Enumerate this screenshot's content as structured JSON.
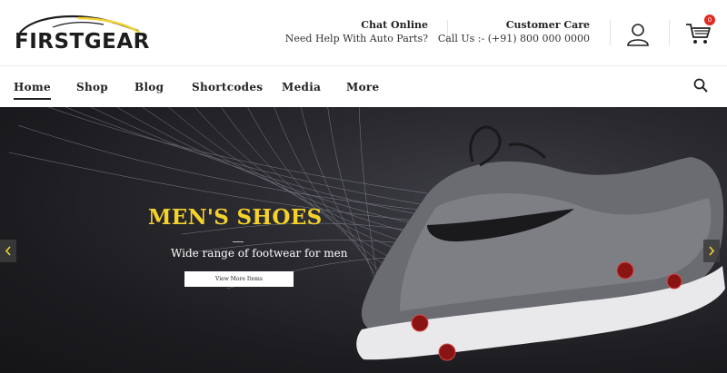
{
  "brand": {
    "name": "FIRSTGEAR",
    "accent": "#f4d22b"
  },
  "header": {
    "chat": {
      "title": "Chat Online",
      "subtitle": "Need Help With Auto Parts?"
    },
    "care": {
      "title": "Customer Care",
      "subtitle": "Call Us :- (+91) 800 000 0000"
    },
    "account_icon": "user-icon",
    "cart": {
      "icon": "cart-icon",
      "count": "0"
    }
  },
  "nav": {
    "items": [
      {
        "label": "Home",
        "active": true
      },
      {
        "label": "Shop"
      },
      {
        "label": "Blog"
      },
      {
        "label": "Shortcodes"
      },
      {
        "label": "Media"
      },
      {
        "label": "More"
      }
    ],
    "search_icon": "search-icon"
  },
  "hero": {
    "title": "MEN'S SHOES",
    "subtitle": "Wide range of footwear for men",
    "cta": "View More Items",
    "prev_icon": "chevron-left-icon",
    "next_icon": "chevron-right-icon"
  }
}
